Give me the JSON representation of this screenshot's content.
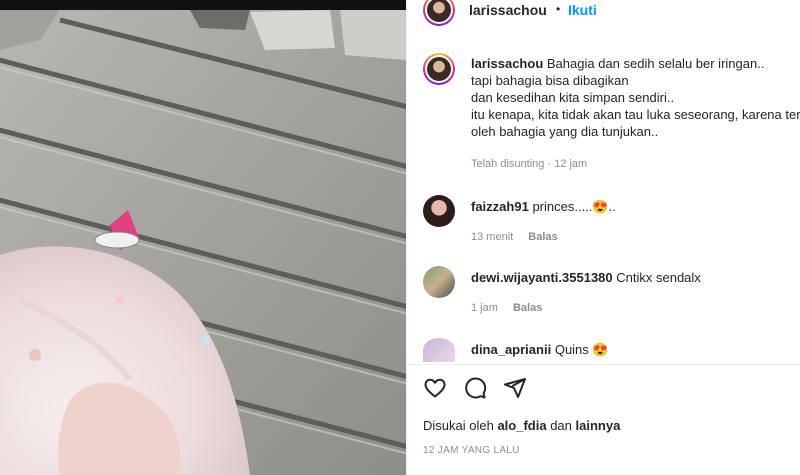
{
  "post": {
    "username": "larissachou",
    "follow_label": "Ikuti",
    "separator": "•",
    "caption_lines": [
      "Bahagia dan sedih selalu ber iringan..",
      "tapi bahagia bisa dibagikan",
      "dan kesedihan kita simpan sendiri..",
      "itu kenapa, kita tidak akan tau luka seseorang, karena terlihat",
      "oleh bahagia yang dia tunjukan.."
    ],
    "caption_meta": "Telah disunting · 12 jam"
  },
  "comments": [
    {
      "username": "faizzah91",
      "text": "princes.....😍..",
      "time": "13 menit",
      "reply": "Balas"
    },
    {
      "username": "dewi.wijayanti.3551380",
      "text": "Cntikx sendalx",
      "time": "1 jam",
      "reply": "Balas"
    },
    {
      "username": "dina_aprianii",
      "text": "Quins 😍",
      "time": "",
      "reply": ""
    }
  ],
  "actions": {
    "like_icon": "heart-icon",
    "comment_icon": "comment-icon",
    "share_icon": "share-icon"
  },
  "likes": {
    "prefix": "Disukai oleh",
    "user": "alo_fdia",
    "conjunction": "dan",
    "others": "lainnya"
  },
  "timestamp": "12 JAM YANG LALU",
  "colors": {
    "accent": "#0095f6",
    "text": "#262626",
    "muted": "#8e8e8e"
  }
}
